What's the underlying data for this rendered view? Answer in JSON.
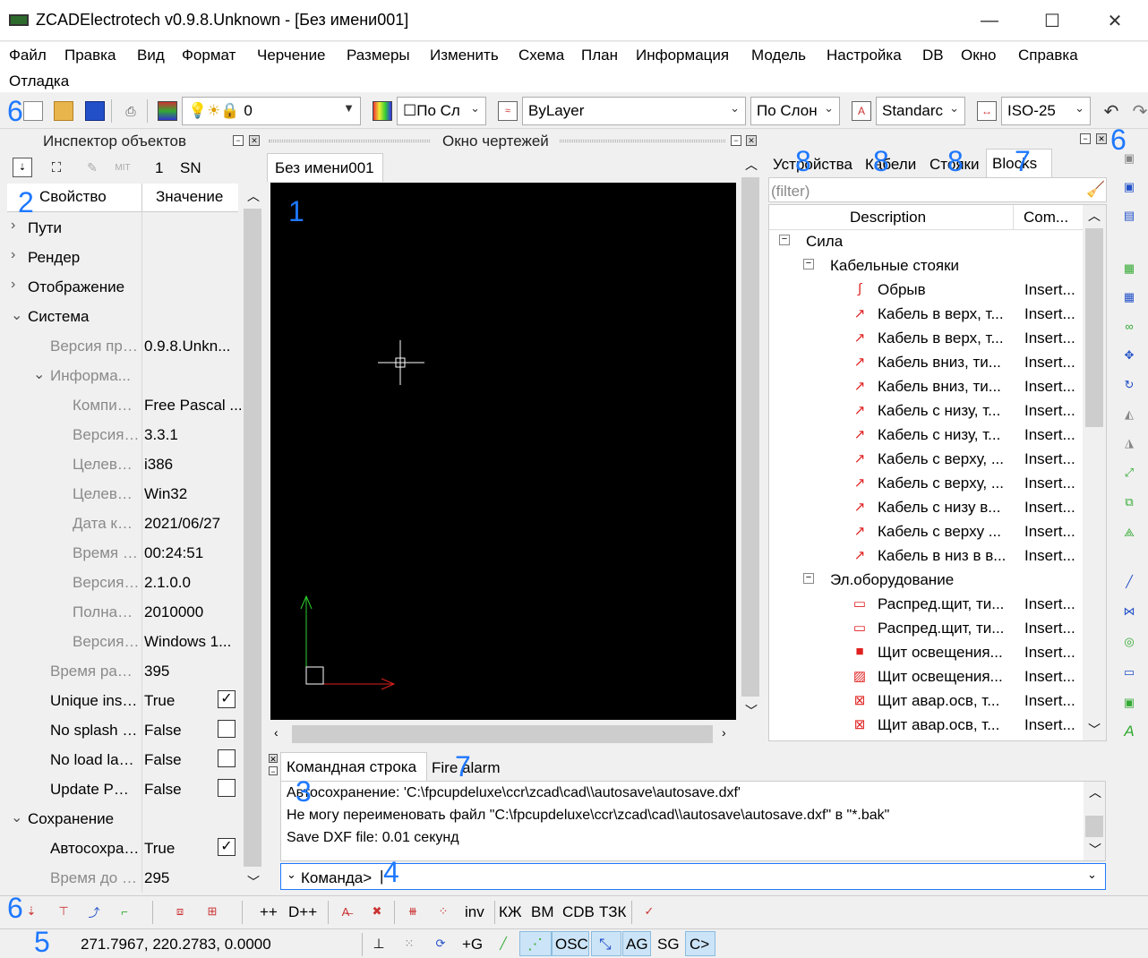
{
  "window": {
    "title": "ZCADElectrotech v0.9.8.Unknown - [Без имени001]"
  },
  "menu": {
    "items": [
      "Файл",
      "Правка",
      "Вид",
      "Формат",
      "Черчение",
      "Размеры",
      "Изменить",
      "Схема",
      "План",
      "Информация",
      "Модель",
      "Настройка",
      "DB",
      "Окно",
      "Справка",
      "Отладка"
    ]
  },
  "toolbar": {
    "layer_value": "0",
    "color_combo": "По Сл",
    "linetype_combo": "ByLayer",
    "lineweight_combo": "По Слон",
    "textstyle_combo": "Standarc",
    "dimstyle_combo": "ISO-25"
  },
  "inspector": {
    "title": "Инспектор объектов",
    "count": "1",
    "sn": "SN",
    "col_property": "Свойство",
    "col_value": "Значение",
    "rows": [
      {
        "k": "Пути",
        "v": ""
      },
      {
        "k": "Рендер",
        "v": ""
      },
      {
        "k": "Отображение",
        "v": ""
      },
      {
        "k": "Система",
        "v": ""
      },
      {
        "k": "Версия прог...",
        "v": "0.9.8.Unkn..."
      },
      {
        "k": "Информа...",
        "v": ""
      },
      {
        "k": "Компилят...",
        "v": "Free Pascal ..."
      },
      {
        "k": "Версия ко...",
        "v": "3.3.1"
      },
      {
        "k": "Целевой ...",
        "v": "i386"
      },
      {
        "k": "Целевая ...",
        "v": "Win32"
      },
      {
        "k": "Дата комп...",
        "v": "2021/06/27"
      },
      {
        "k": "Время ко...",
        "v": "00:24:51"
      },
      {
        "k": "Версия LCL",
        "v": "2.1.0.0"
      },
      {
        "k": "Полная ве...",
        "v": "2010000"
      },
      {
        "k": "Версия ок...",
        "v": "Windows 1..."
      },
      {
        "k": "Время работы",
        "v": "395"
      },
      {
        "k": "Unique instan...",
        "v": "True"
      },
      {
        "k": "No splash scr...",
        "v": "False"
      },
      {
        "k": "No load layout",
        "v": "False"
      },
      {
        "k": "Update PO file",
        "v": "False"
      },
      {
        "k": "Сохранение",
        "v": ""
      },
      {
        "k": "Автосохране...",
        "v": "True"
      },
      {
        "k": "Время до авт...",
        "v": "295"
      }
    ]
  },
  "drawings": {
    "title": "Окно чертежей",
    "tab": "Без имени001"
  },
  "right_panel": {
    "tabs": [
      "Устройства",
      "Кабели",
      "Стояки",
      "Blocks"
    ],
    "filter_placeholder": "(filter)",
    "col_description": "Description",
    "col_com": "Com...",
    "tree": [
      {
        "label": "Сила",
        "com": ""
      },
      {
        "label": "Кабельные стояки",
        "com": ""
      },
      {
        "label": "Обрыв",
        "com": "Insert..."
      },
      {
        "label": "Кабель в верх, т...",
        "com": "Insert..."
      },
      {
        "label": "Кабель в верх, т...",
        "com": "Insert..."
      },
      {
        "label": "Кабель вниз, ти...",
        "com": "Insert..."
      },
      {
        "label": "Кабель вниз, ти...",
        "com": "Insert..."
      },
      {
        "label": "Кабель с низу, т...",
        "com": "Insert..."
      },
      {
        "label": "Кабель с низу, т...",
        "com": "Insert..."
      },
      {
        "label": "Кабель с верху, ...",
        "com": "Insert..."
      },
      {
        "label": "Кабель с верху, ...",
        "com": "Insert..."
      },
      {
        "label": "Кабель с низу в...",
        "com": "Insert..."
      },
      {
        "label": "Кабель с верху ...",
        "com": "Insert..."
      },
      {
        "label": "Кабель в низ в в...",
        "com": "Insert..."
      },
      {
        "label": "Эл.оборудование",
        "com": ""
      },
      {
        "label": "Распред.щит, ти...",
        "com": "Insert..."
      },
      {
        "label": "Распред.щит, ти...",
        "com": "Insert..."
      },
      {
        "label": "Щит освещения...",
        "com": "Insert..."
      },
      {
        "label": "Щит освещения...",
        "com": "Insert..."
      },
      {
        "label": "Щит авар.осв, т...",
        "com": "Insert..."
      },
      {
        "label": "Щит авар.осв, т...",
        "com": "Insert..."
      }
    ]
  },
  "command": {
    "tabs": [
      "Командная строка",
      "Fire alarm"
    ],
    "output": [
      "Автосохранение: 'C:\\fpcupdeluxe\\ccr\\zcad\\cad\\\\autosave\\autosave.dxf'",
      "Не могу переименовать файл \"C:\\fpcupdeluxe\\ccr\\zcad\\cad\\\\autosave\\autosave.dxf\" в \"*.bak\"",
      "Save DXF file:  0.01 секунд"
    ],
    "prompt": "Команда>"
  },
  "bottom_toolbar": {
    "labels": [
      "++",
      "D++",
      "inv",
      "КЖ",
      "ВМ",
      "CDB",
      "ТЗК"
    ]
  },
  "status": {
    "coords": "271.7967, 220.2783, 0.0000",
    "buttons": [
      "+G",
      "OSC",
      "AG",
      "SG",
      "C>"
    ]
  },
  "callouts": [
    "1",
    "2",
    "3",
    "4",
    "5",
    "6",
    "6",
    "6",
    "7",
    "7",
    "8",
    "8",
    "8"
  ],
  "colors": {
    "accent": "#1e78ff",
    "canvas": "#000000",
    "red_icon": "#e02020"
  }
}
